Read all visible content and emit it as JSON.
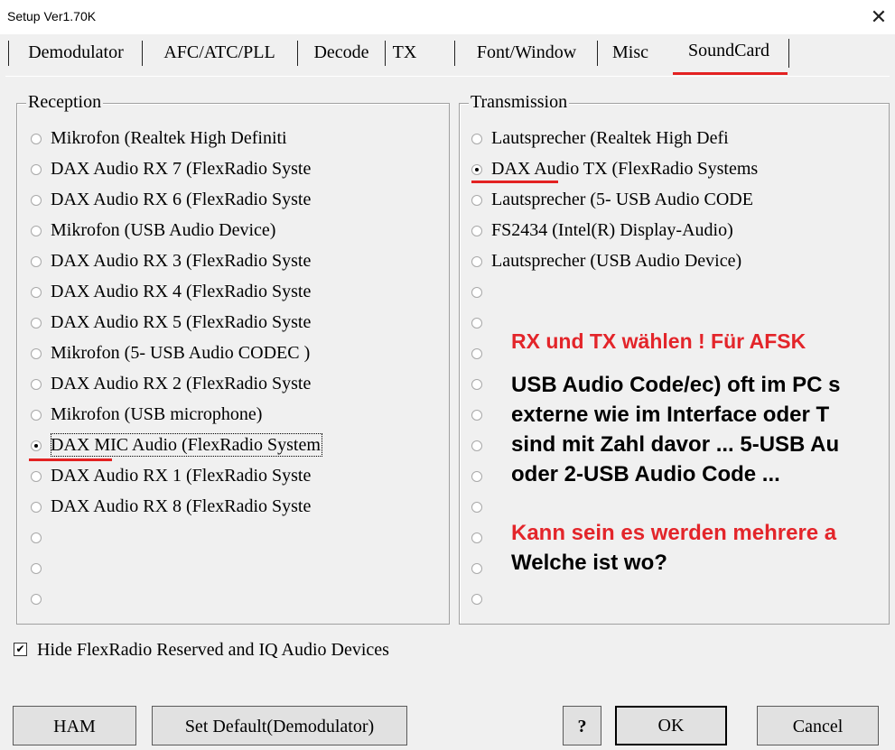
{
  "window": {
    "title": "Setup Ver1.70K",
    "close_glyph": "✕"
  },
  "tabs": [
    {
      "label": "Demodulator"
    },
    {
      "label": "AFC/ATC/PLL"
    },
    {
      "label": "Decode"
    },
    {
      "label": "TX"
    },
    {
      "label": "Font/Window"
    },
    {
      "label": "Misc"
    },
    {
      "label": "SoundCard",
      "active": true
    }
  ],
  "reception": {
    "label": "Reception",
    "selected_index": 10,
    "items": [
      "Mikrofon (Realtek High Definiti",
      "DAX Audio RX 7 (FlexRadio Syste",
      "DAX Audio RX 6 (FlexRadio Syste",
      "Mikrofon (USB Audio Device)",
      "DAX Audio RX 3 (FlexRadio Syste",
      "DAX Audio RX 4 (FlexRadio Syste",
      "DAX Audio RX 5 (FlexRadio Syste",
      "Mikrofon (5- USB Audio CODEC )",
      "DAX Audio RX 2 (FlexRadio Syste",
      "Mikrofon (USB microphone)",
      "DAX MIC Audio (FlexRadio System",
      "DAX Audio RX 1 (FlexRadio Syste",
      "DAX Audio RX 8 (FlexRadio Syste",
      "",
      "",
      ""
    ]
  },
  "transmission": {
    "label": "Transmission",
    "selected_index": 1,
    "items": [
      "Lautsprecher (Realtek High Defi",
      "DAX Audio TX (FlexRadio Systems",
      "Lautsprecher (5- USB Audio CODE",
      "FS2434 (Intel(R) Display-Audio)",
      "Lautsprecher (USB Audio Device)",
      "",
      "",
      "",
      "",
      "",
      "",
      "",
      "",
      "",
      "",
      ""
    ]
  },
  "annotation": {
    "line1": "RX und TX wählen ! Für AFSK",
    "line2": "USB Audio Code/ec) oft im PC s",
    "line3": "externe wie im Interface oder T",
    "line4": "sind mit Zahl davor  ... 5-USB Au",
    "line5": "oder 2-USB Audio Code ...",
    "line6": "Kann sein es werden mehrere a",
    "line7": "Welche ist wo?",
    "color_red": "#e3252a"
  },
  "options": {
    "hide_label": "Hide FlexRadio Reserved and IQ Audio Devices",
    "hide_checked": true
  },
  "buttons": {
    "ham": "HAM",
    "set_default": "Set Default(Demodulator)",
    "help": "?",
    "ok": "OK",
    "cancel": "Cancel"
  }
}
